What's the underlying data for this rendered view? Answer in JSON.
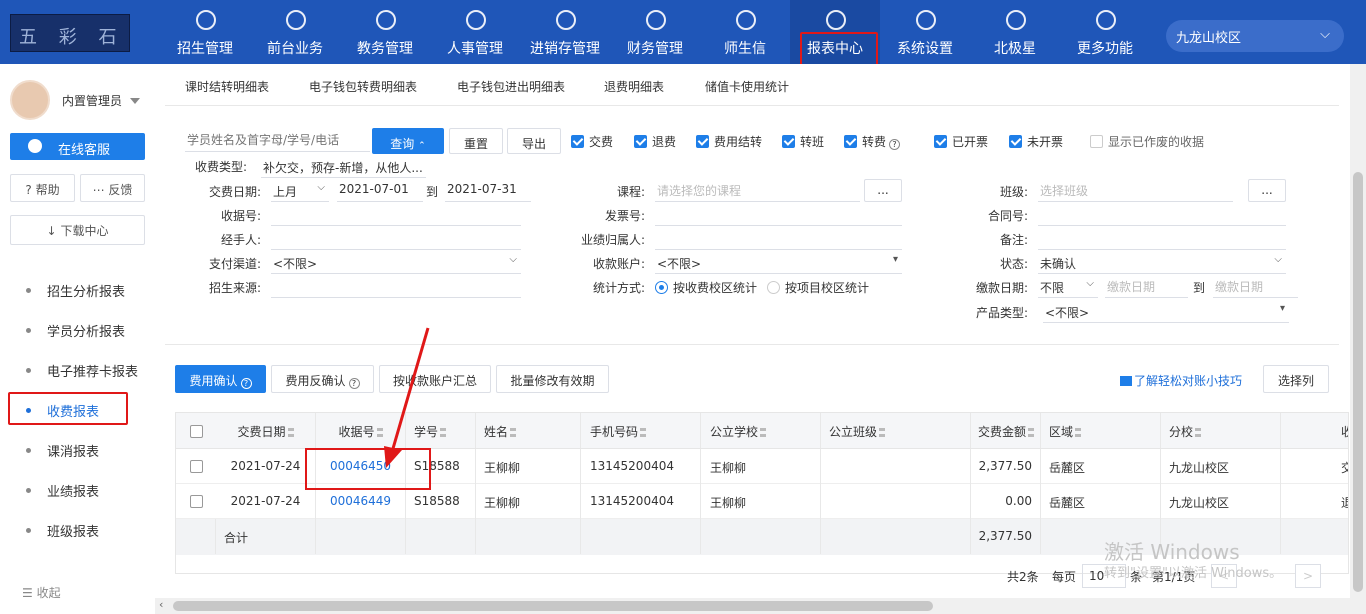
{
  "brand": {
    "logo_text": "五 彩 石"
  },
  "nav": [
    {
      "label": "招生管理",
      "icon": "user-add-icon"
    },
    {
      "label": "前台业务",
      "icon": "desk-icon"
    },
    {
      "label": "教务管理",
      "icon": "book-icon"
    },
    {
      "label": "人事管理",
      "icon": "person-icon"
    },
    {
      "label": "进销存管理",
      "icon": "inventory-icon"
    },
    {
      "label": "财务管理",
      "icon": "finance-icon"
    },
    {
      "label": "师生信",
      "icon": "message-icon"
    },
    {
      "label": "报表中心",
      "icon": "report-icon"
    },
    {
      "label": "系统设置",
      "icon": "settings-icon"
    },
    {
      "label": "北极星",
      "icon": "star-icon"
    },
    {
      "label": "更多功能",
      "icon": "more-icon"
    }
  ],
  "campus": {
    "value": "九龙山校区"
  },
  "user": {
    "name": "内置管理员"
  },
  "sidebar": {
    "service": "在线客服",
    "help": "帮助",
    "feedback": "反馈",
    "download": "下载中心",
    "items": [
      "招生分析报表",
      "学员分析报表",
      "电子推荐卡报表",
      "收费报表",
      "课消报表",
      "业绩报表",
      "班级报表"
    ],
    "collapse": "收起"
  },
  "tabs": [
    "课时结转明细表",
    "电子钱包转费明细表",
    "电子钱包进出明细表",
    "退费明细表",
    "储值卡使用统计"
  ],
  "search": {
    "placeholder": "学员姓名及首字母/学号/电话"
  },
  "buttons": {
    "query": "查询",
    "reset": "重置",
    "export": "导出"
  },
  "checkboxes": [
    {
      "label": "交费",
      "checked": true
    },
    {
      "label": "退费",
      "checked": true
    },
    {
      "label": "费用结转",
      "checked": true
    },
    {
      "label": "转班",
      "checked": true
    },
    {
      "label": "转费",
      "checked": true
    },
    {
      "label": "已开票",
      "checked": true
    },
    {
      "label": "未开票",
      "checked": true
    },
    {
      "label": "显示已作废的收据",
      "checked": false
    }
  ],
  "filters": {
    "fee_type_label": "收费类型:",
    "fee_type_value": "补欠交，预存-新增，从他人...",
    "pay_date_label": "交费日期:",
    "pay_date_range": "上月",
    "date_from": "2021-07-01",
    "date_to_label": "到",
    "date_to": "2021-07-31",
    "receipt_label": "收据号:",
    "handler_label": "经手人:",
    "pay_channel_label": "支付渠道:",
    "pay_channel_value": "<不限>",
    "source_label": "招生来源:",
    "course_label": "课程:",
    "course_placeholder": "请选择您的课程",
    "invoice_label": "发票号:",
    "perf_label": "业绩归属人:",
    "account_label": "收款账户:",
    "account_value": "<不限>",
    "stat_label": "统计方式:",
    "stat_opt1": "按收费校区统计",
    "stat_opt2": "按项目校区统计",
    "class_label": "班级:",
    "class_placeholder": "选择班级",
    "contract_label": "合同号:",
    "remark_label": "备注:",
    "status_label": "状态:",
    "status_value": "未确认",
    "due_label": "缴款日期:",
    "due_range": "不限",
    "due_from_ph": "缴款日期",
    "due_to_label": "到",
    "due_to_ph": "缴款日期",
    "product_label": "产品类型:",
    "product_value": "<不限>",
    "more": "..."
  },
  "actions": {
    "confirm": "费用确认",
    "unconfirm": "费用反确认",
    "by_account": "按收款账户汇总",
    "batch": "批量修改有效期",
    "tips": "了解轻松对账小技巧",
    "columns": "选择列"
  },
  "table": {
    "headers": [
      "交费日期",
      "收据号",
      "学号",
      "姓名",
      "手机号码",
      "公立学校",
      "公立班级",
      "交费金额",
      "区域",
      "分校",
      "收"
    ],
    "rows": [
      [
        "2021-07-24",
        "00046450",
        "S18588",
        "王柳柳",
        "13145200404",
        "王柳柳",
        "",
        "2,377.50",
        "岳麓区",
        "九龙山校区",
        "交"
      ],
      [
        "2021-07-24",
        "00046449",
        "S18588",
        "王柳柳",
        "13145200404",
        "王柳柳",
        "",
        "0.00",
        "岳麓区",
        "九龙山校区",
        "退"
      ]
    ],
    "sum_label": "合计",
    "sum_value": "2,377.50"
  },
  "pager": {
    "total": "共2条",
    "per_page_label": "每页",
    "per_page": "10",
    "unit": "条",
    "page": "第1/1页",
    "prev": "<",
    "next": ">"
  },
  "watermark": {
    "line1": "激活 Windows",
    "line2": "转到\"设置\"以激活 Windows。"
  },
  "colors": {
    "topbar": "#1f56b8",
    "primary": "#1e7ee8",
    "highlight": "#e01818"
  }
}
